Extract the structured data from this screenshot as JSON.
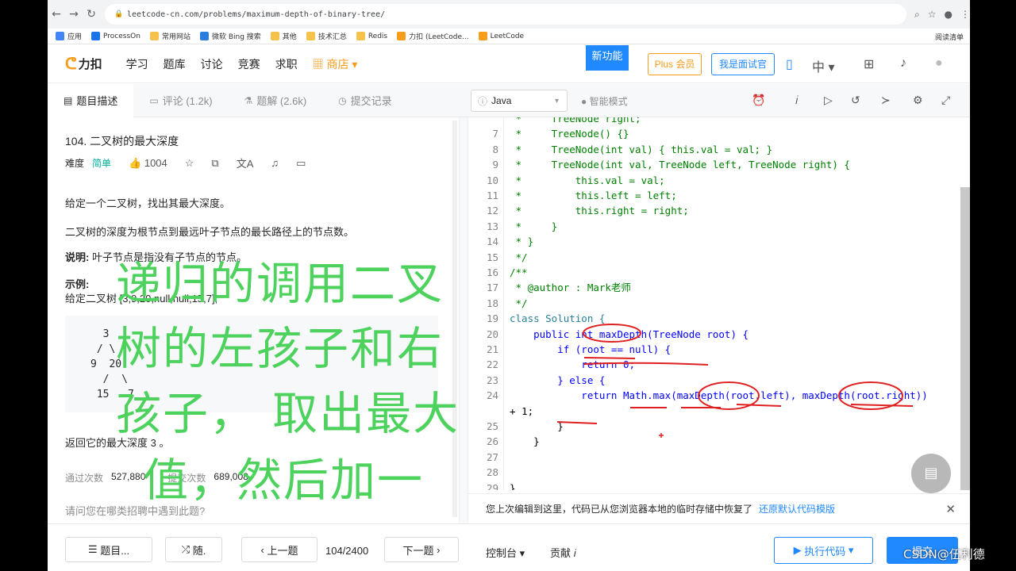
{
  "browser": {
    "url": "leetcode-cn.com/problems/maximum-depth-of-binary-tree/",
    "bookmarks": [
      "应用",
      "ProcessOn",
      "常用网站",
      "微软 Bing 搜索",
      "其他",
      "技术汇总",
      "Redis",
      "力扣 (LeetCode...",
      "LeetCode"
    ],
    "reading_list": "阅读清单"
  },
  "nav": {
    "logo": "力扣",
    "links": [
      "学习",
      "题库",
      "讨论",
      "竞赛",
      "求职"
    ],
    "shop": "商店",
    "new_feature": "新功能",
    "plus": "Plus 会员",
    "interviewer": "我是面试官",
    "lang": "中"
  },
  "tabs": {
    "description": "题目描述",
    "comments": "评论 (1.2k)",
    "solutions": "题解 (2.6k)",
    "submissions": "提交记录",
    "language": "Java",
    "smart_mode": "智能模式"
  },
  "problem": {
    "title": "104. 二叉树的最大深度",
    "difficulty_label": "难度",
    "difficulty": "简单",
    "likes": "1004",
    "p1": "给定一个二叉树，找出其最大深度。",
    "p2": "二叉树的深度为根节点到最远叶子节点的最长路径上的节点数。",
    "note_label": "说明:",
    "note": "叶子节点是指没有子节点的节点。",
    "example_label": "示例:",
    "example_text": "给定二叉树 [3,9,20,null,null,15,7],",
    "tree": "  3\n / \\\n9  20\n  /  \\\n 15   7",
    "result": "返回它的最大深度 3 。",
    "accepted_label": "通过次数",
    "accepted": "527,880",
    "submitted_label": "提交次数",
    "submitted": "689,008",
    "question": "请问您在哪类招聘中遇到此题?"
  },
  "code": {
    "lines": [
      {
        "n": "",
        "t": " *     TreeNode right;",
        "c": "cm"
      },
      {
        "n": "7",
        "t": " *     TreeNode() {}",
        "c": "cm"
      },
      {
        "n": "8",
        "t": " *     TreeNode(int val) { this.val = val; }",
        "c": "cm"
      },
      {
        "n": "9",
        "t": " *     TreeNode(int val, TreeNode left, TreeNode right) {",
        "c": "cm"
      },
      {
        "n": "10",
        "t": " *         this.val = val;",
        "c": "cm"
      },
      {
        "n": "11",
        "t": " *         this.left = left;",
        "c": "cm"
      },
      {
        "n": "12",
        "t": " *         this.right = right;",
        "c": "cm"
      },
      {
        "n": "13",
        "t": " *     }",
        "c": "cm"
      },
      {
        "n": "14",
        "t": " * }",
        "c": "cm"
      },
      {
        "n": "15",
        "t": " */",
        "c": "cm"
      },
      {
        "n": "16",
        "t": "/**",
        "c": "cm"
      },
      {
        "n": "17",
        "t": " * @author : Mark老师",
        "c": "cm"
      },
      {
        "n": "18",
        "t": " */",
        "c": "cm"
      },
      {
        "n": "19",
        "t": "class Solution {",
        "c": "ty"
      },
      {
        "n": "20",
        "t": "    public int maxDepth(TreeNode root) {",
        "c": "kw"
      },
      {
        "n": "21",
        "t": "        if (root == null) {",
        "c": "kw"
      },
      {
        "n": "22",
        "t": "            return 0;",
        "c": "kw"
      },
      {
        "n": "23",
        "t": "        } else {",
        "c": "kw"
      },
      {
        "n": "24",
        "t": "            return Math.max(maxDepth(root.left), maxDepth(root.right))",
        "c": "kw"
      },
      {
        "n": "",
        "t": "+ 1;",
        "c": "tx"
      },
      {
        "n": "25",
        "t": "        }",
        "c": "tx"
      },
      {
        "n": "26",
        "t": "    }",
        "c": "tx"
      },
      {
        "n": "27",
        "t": "",
        "c": "tx"
      },
      {
        "n": "28",
        "t": "",
        "c": "tx"
      },
      {
        "n": "29",
        "t": "}",
        "c": "tx"
      }
    ],
    "restore_msg": "您上次编辑到这里，代码已从您浏览器本地的临时存储中恢复了",
    "restore_link": "还原默认代码模版"
  },
  "bottom": {
    "list": "题目...",
    "random": "随.",
    "prev": "上一题",
    "page": "104/2400",
    "next": "下一题",
    "console": "控制台",
    "contrib": "贡献",
    "run": "执行代码",
    "submit": "提交"
  },
  "overlay": {
    "line1": "递归的调用二叉",
    "line2": "树的左孩子和右",
    "line3": "孩子， 取出最大",
    "line4": "值，然后加一",
    "watermark": "CSDN@伍利德"
  }
}
